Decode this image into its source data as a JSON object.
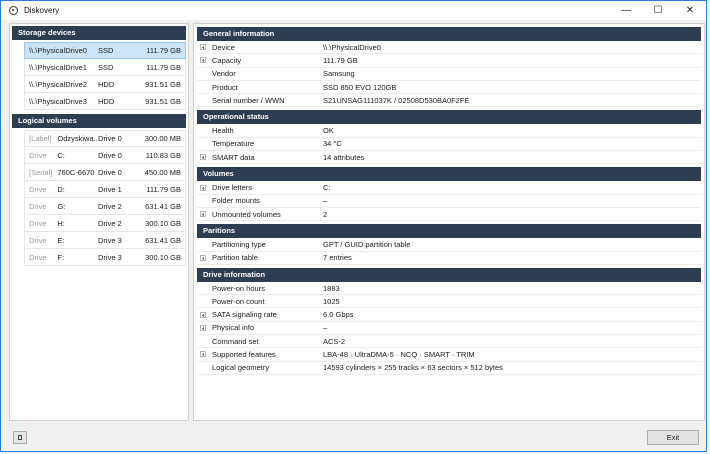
{
  "window": {
    "title": "Diskovery",
    "minimize": "—",
    "maximize": "☐",
    "close": "✕"
  },
  "storage": {
    "header": "Storage devices",
    "items": [
      {
        "name": "\\\\.\\PhysicalDrive0",
        "type": "SSD",
        "size": "111.79 GB",
        "selected": true
      },
      {
        "name": "\\\\.\\PhysicalDrive1",
        "type": "SSD",
        "size": "111.79 GB"
      },
      {
        "name": "\\\\.\\PhysicalDrive2",
        "type": "HDD",
        "size": "931.51 GB"
      },
      {
        "name": "\\\\.\\PhysicalDrive3",
        "type": "HDD",
        "size": "931.51 GB"
      }
    ]
  },
  "volumes": {
    "header": "Logical volumes",
    "items": [
      {
        "kind": "[Label]",
        "name": "Odzyskiwa...",
        "drive": "Drive 0",
        "size": "300.00 MB"
      },
      {
        "kind": "Drive",
        "name": "C:",
        "drive": "Drive 0",
        "size": "110.83 GB"
      },
      {
        "kind": "[Serial]",
        "name": "760C-6670",
        "drive": "Drive 0",
        "size": "450.00 MB"
      },
      {
        "kind": "Drive",
        "name": "D:",
        "drive": "Drive 1",
        "size": "111.79 GB"
      },
      {
        "kind": "Drive",
        "name": "G:",
        "drive": "Drive 2",
        "size": "631.41 GB"
      },
      {
        "kind": "Drive",
        "name": "H:",
        "drive": "Drive 2",
        "size": "300.10 GB"
      },
      {
        "kind": "Drive",
        "name": "E:",
        "drive": "Drive 3",
        "size": "631.41 GB"
      },
      {
        "kind": "Drive",
        "name": "F:",
        "drive": "Drive 3",
        "size": "300.10 GB"
      }
    ]
  },
  "details": {
    "sections": [
      {
        "header": "General information",
        "rows": [
          {
            "key": "Device",
            "value": "\\\\.\\PhysicalDrive0",
            "expand": true
          },
          {
            "key": "Capacity",
            "value": "111.79 GB",
            "expand": true
          },
          {
            "key": "Vendor",
            "value": "Samsung"
          },
          {
            "key": "Product",
            "value": "SSD 850 EVO 120GB"
          },
          {
            "key": "Serial number / WWN",
            "value": "S21UNSAG111037K / 02508D530BA0F2FE"
          }
        ]
      },
      {
        "header": "Operational status",
        "rows": [
          {
            "key": "Health",
            "value": "OK"
          },
          {
            "key": "Temperature",
            "value": "34 °C"
          },
          {
            "key": "SMART data",
            "value": "14 attributes",
            "expand": true
          }
        ]
      },
      {
        "header": "Volumes",
        "rows": [
          {
            "key": "Drive letters",
            "value": "C:",
            "expand": true
          },
          {
            "key": "Folder mounts",
            "value": "–"
          },
          {
            "key": "Unmounted volumes",
            "value": "2",
            "expand": true
          }
        ]
      },
      {
        "header": "Paritions",
        "rows": [
          {
            "key": "Partitioning type",
            "value": "GPT / GUID partition table"
          },
          {
            "key": "Partition table",
            "value": "7 entries",
            "expand": true
          }
        ]
      },
      {
        "header": "Drive information",
        "rows": [
          {
            "key": "Power-on hours",
            "value": "1883"
          },
          {
            "key": "Power-on count",
            "value": "1025"
          },
          {
            "key": "SATA signaling rate",
            "value": "6.0 Gbps",
            "expand": true
          },
          {
            "key": "Physical info",
            "value": "–",
            "expand": true
          },
          {
            "key": "Command set",
            "value": "ACS-2"
          },
          {
            "key": "Supported features",
            "value": "LBA-48 · UltraDMA-5 · NCQ · SMART · TRIM",
            "expand": true
          },
          {
            "key": "Logical geometry",
            "value": "14593 cylinders × 255 tracks × 63 sectors × 512 bytes"
          }
        ]
      }
    ]
  },
  "footer": {
    "exit_label": "Exit"
  }
}
